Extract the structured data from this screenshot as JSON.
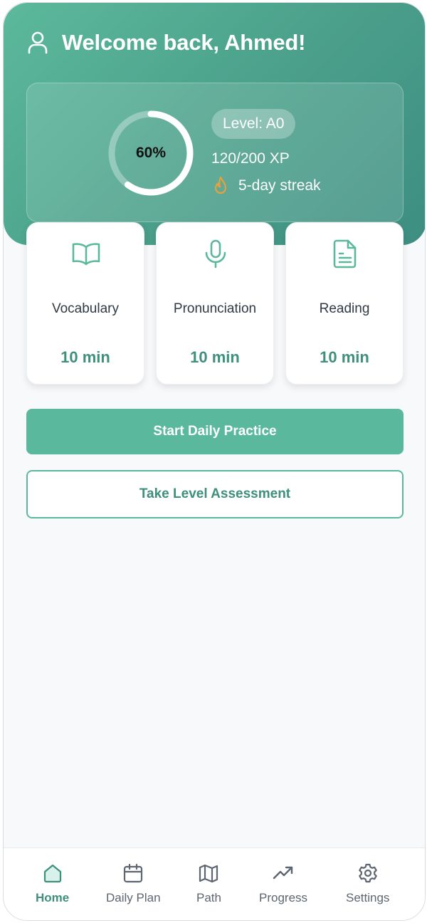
{
  "header": {
    "welcome": "Welcome back, Ahmed!",
    "progress_percent_label": "60%",
    "progress_fraction": 0.6,
    "level": "Level: A0",
    "xp": "120/200 XP",
    "streak": "5-day streak"
  },
  "modules": [
    {
      "title": "Vocabulary",
      "time": "10 min",
      "icon": "book-open-icon"
    },
    {
      "title": "Pronunciation",
      "time": "10 min",
      "icon": "microphone-icon"
    },
    {
      "title": "Reading",
      "time": "10 min",
      "icon": "document-icon"
    }
  ],
  "actions": {
    "start_daily": "Start Daily Practice",
    "take_assessment": "Take Level Assessment"
  },
  "nav": {
    "items": [
      {
        "label": "Home",
        "icon": "home-icon",
        "active": true
      },
      {
        "label": "Daily Plan",
        "icon": "calendar-icon",
        "active": false
      },
      {
        "label": "Path",
        "icon": "map-icon",
        "active": false
      },
      {
        "label": "Progress",
        "icon": "trending-up-icon",
        "active": false
      },
      {
        "label": "Settings",
        "icon": "gear-icon",
        "active": false
      }
    ]
  },
  "colors": {
    "accent": "#5ab99d",
    "accent_dark": "#3f8f7d",
    "flame": "#e8a13a"
  }
}
